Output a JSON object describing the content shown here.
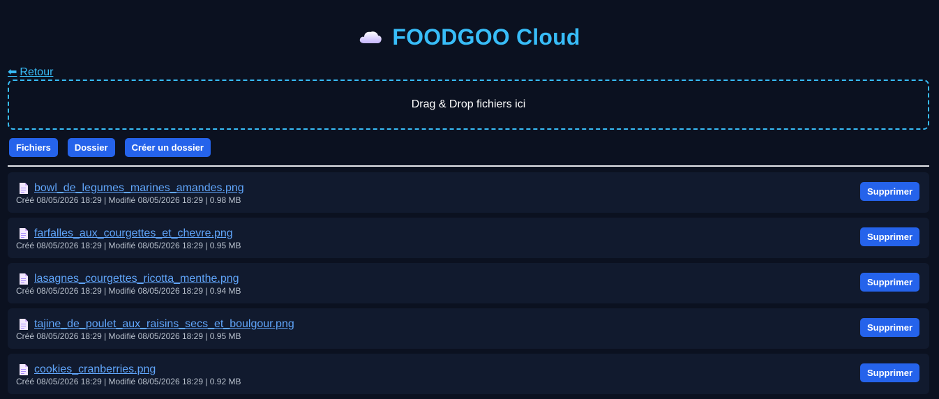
{
  "header": {
    "icon": "cloud-icon",
    "title": "FOODGOO Cloud"
  },
  "nav": {
    "back_arrow": "⬅",
    "back_label": "Retour"
  },
  "dropzone": {
    "label": "Drag & Drop fichiers ici"
  },
  "toolbar": {
    "files_label": "Fichiers",
    "folder_label": "Dossier",
    "create_folder_label": "Créer un dossier"
  },
  "files": [
    {
      "name": "bowl_de_legumes_marines_amandes.png",
      "meta": "Créé 08/05/2026 18:29 | Modifié 08/05/2026 18:29 | 0.98 MB",
      "delete_label": "Supprimer"
    },
    {
      "name": "farfalles_aux_courgettes_et_chevre.png",
      "meta": "Créé 08/05/2026 18:29 | Modifié 08/05/2026 18:29 | 0.95 MB",
      "delete_label": "Supprimer"
    },
    {
      "name": "lasagnes_courgettes_ricotta_menthe.png",
      "meta": "Créé 08/05/2026 18:29 | Modifié 08/05/2026 18:29 | 0.94 MB",
      "delete_label": "Supprimer"
    },
    {
      "name": "tajine_de_poulet_aux_raisins_secs_et_boulgour.png",
      "meta": "Créé 08/05/2026 18:29 | Modifié 08/05/2026 18:29 | 0.95 MB",
      "delete_label": "Supprimer"
    },
    {
      "name": "cookies_cranberries.png",
      "meta": "Créé 08/05/2026 18:29 | Modifié 08/05/2026 18:29 | 0.92 MB",
      "delete_label": "Supprimer"
    }
  ],
  "colors": {
    "background": "#0b1120",
    "accent": "#38bdf8",
    "button": "#2563eb",
    "row": "#111a2e",
    "link": "#60a5fa"
  }
}
